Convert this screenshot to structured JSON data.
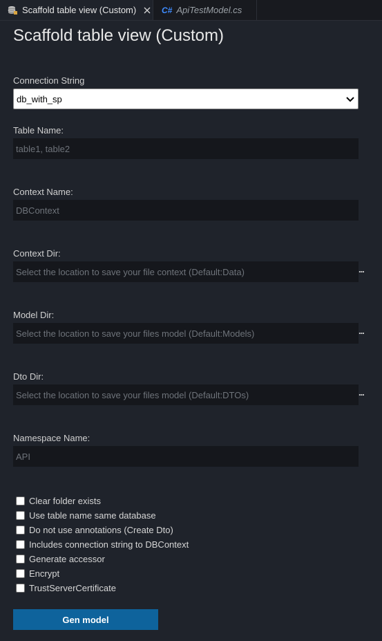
{
  "tabs": [
    {
      "label": "Scaffold table view (Custom)",
      "icon": "database-icon",
      "close": "close-icon"
    },
    {
      "label": "ApiTestModel.cs",
      "icon": "csharp-file-icon",
      "icon_text": "C#"
    }
  ],
  "title": "Scaffold table view (Custom)",
  "connection": {
    "label": "Connection String",
    "selected": "db_with_sp"
  },
  "fields": {
    "table_name": {
      "label": "Table Name:",
      "placeholder": "table1, table2"
    },
    "context_name": {
      "label": "Context Name:",
      "placeholder": "DBContext"
    },
    "context_dir": {
      "label": "Context Dir:",
      "placeholder": "Select the location to save your file context (Default:Data)",
      "browse": "..."
    },
    "model_dir": {
      "label": "Model Dir:",
      "placeholder": "Select the location to save your files model (Default:Models)",
      "browse": "..."
    },
    "dto_dir": {
      "label": "Dto Dir:",
      "placeholder": "Select the location to save your files model (Default:DTOs)",
      "browse": "..."
    },
    "namespace_name": {
      "label": "Namespace Name:",
      "placeholder": "API"
    }
  },
  "checkboxes": [
    {
      "label": "Clear folder exists",
      "checked": false
    },
    {
      "label": "Use table name same database",
      "checked": false
    },
    {
      "label": "Do not use annotations (Create Dto)",
      "checked": false
    },
    {
      "label": "Includes connection string to DBContext",
      "checked": false
    },
    {
      "label": "Generate accessor",
      "checked": false
    },
    {
      "label": "Encrypt",
      "checked": false
    },
    {
      "label": "TrustServerCertificate",
      "checked": false
    }
  ],
  "button": {
    "label": "Gen model",
    "color": "#0e639c"
  },
  "colors": {
    "background": "#1f232b",
    "input_bg": "#15171c",
    "tabbar": "#181a1f"
  }
}
